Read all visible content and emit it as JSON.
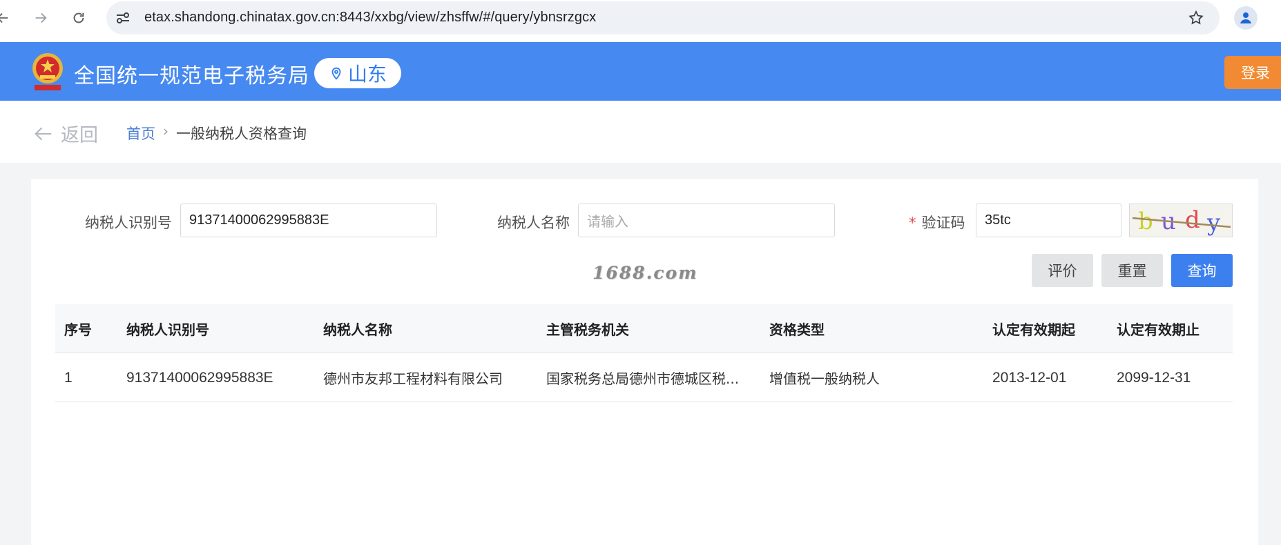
{
  "browser": {
    "url": "etax.shandong.chinatax.gov.cn:8443/xxbg/view/zhsffw/#/query/ybnsrzgcx"
  },
  "header": {
    "site_title": "全国统一规范电子税务局",
    "region": "山东",
    "login_label": "登录"
  },
  "breadcrumb": {
    "back_label": "返回",
    "home": "首页",
    "separator": "›",
    "current": "一般纳税人资格查询"
  },
  "form": {
    "taxpayer_id_label": "纳税人识别号",
    "taxpayer_id_value": "91371400062995883E",
    "taxpayer_name_label": "纳税人名称",
    "taxpayer_name_placeholder": "请输入",
    "captcha_required_mark": "*",
    "captcha_label": "验证码",
    "captcha_value": "35tc",
    "captcha_image_text": "budy"
  },
  "buttons": {
    "rate": "评价",
    "reset": "重置",
    "query": "查询"
  },
  "watermark": "1688.com",
  "table": {
    "columns": [
      "序号",
      "纳税人识别号",
      "纳税人名称",
      "主管税务机关",
      "资格类型",
      "认定有效期起",
      "认定有效期止"
    ],
    "rows": [
      [
        "1",
        "91371400062995883E",
        "德州市友邦工程材料有限公司",
        "国家税务总局德州市德城区税...",
        "增值税一般纳税人",
        "2013-12-01",
        "2099-12-31"
      ]
    ]
  },
  "colors": {
    "header_blue": "#4689f1",
    "login_orange": "#f18a32",
    "query_blue": "#3c80ef"
  }
}
